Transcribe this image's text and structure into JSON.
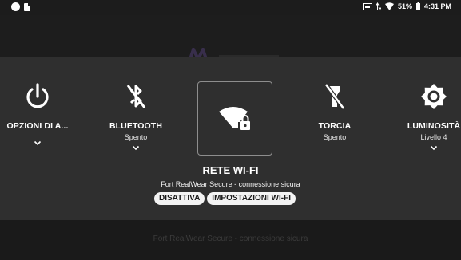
{
  "status_bar": {
    "battery_percent": "51%",
    "time": "4:31 PM"
  },
  "background": {
    "footer_text": "Fort RealWear Secure - connessione sicura"
  },
  "tiles": [
    {
      "label": "OPZIONI DI A...",
      "sub": "",
      "icon": "power-icon"
    },
    {
      "label": "BLUETOOTH",
      "sub": "Spento",
      "icon": "bluetooth-off-icon"
    },
    {
      "label": "TORCIA",
      "sub": "Spento",
      "icon": "flashlight-off-icon"
    },
    {
      "label": "LUMINOSITÀ",
      "sub": "Livello 4",
      "icon": "brightness-icon"
    }
  ],
  "wifi": {
    "title": "RETE WI-FI",
    "subtitle": "Fort RealWear Secure - connessione sicura",
    "disable_label": "DISATTIVA",
    "settings_label": "IMPOSTAZIONI WI-FI",
    "icon": "wifi-secure-icon"
  },
  "colors": {
    "overlay": "#2f2f2f",
    "background": "#161616",
    "button": "#f3f3f3"
  }
}
